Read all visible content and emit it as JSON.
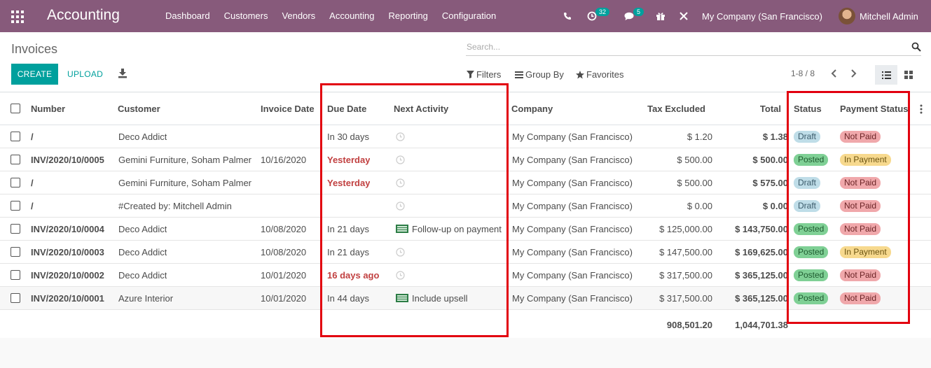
{
  "app": {
    "title": "Accounting"
  },
  "menu": [
    "Dashboard",
    "Customers",
    "Vendors",
    "Accounting",
    "Reporting",
    "Configuration"
  ],
  "systray": {
    "activity_count": "32",
    "message_count": "5",
    "company": "My Company (San Francisco)",
    "user": "Mitchell Admin"
  },
  "page": {
    "title": "Invoices"
  },
  "buttons": {
    "create": "CREATE",
    "upload": "UPLOAD"
  },
  "search": {
    "placeholder": "Search..."
  },
  "filters": {
    "filters": "Filters",
    "group_by": "Group By",
    "favorites": "Favorites"
  },
  "pager": {
    "text": "1-8 / 8"
  },
  "columns": [
    "Number",
    "Customer",
    "Invoice Date",
    "Due Date",
    "Next Activity",
    "Company",
    "Tax Excluded",
    "Total",
    "Status",
    "Payment Status"
  ],
  "rows": [
    {
      "number": "/",
      "customer": "Deco Addict",
      "invoice_date": "",
      "due_date": "In 30 days",
      "due_overdue": false,
      "activity": "",
      "activity_icon": "clock-icon",
      "company": "My Company (San Francisco)",
      "tax_excluded": "$ 1.20",
      "total": "$ 1.38",
      "status": "Draft",
      "payment_status": "Not Paid"
    },
    {
      "number": "INV/2020/10/0005",
      "customer": "Gemini Furniture, Soham Palmer",
      "invoice_date": "10/16/2020",
      "due_date": "Yesterday",
      "due_overdue": true,
      "activity": "",
      "activity_icon": "clock-icon",
      "company": "My Company (San Francisco)",
      "tax_excluded": "$ 500.00",
      "total": "$ 500.00",
      "status": "Posted",
      "payment_status": "In Payment"
    },
    {
      "number": "/",
      "customer": "Gemini Furniture, Soham Palmer",
      "invoice_date": "",
      "due_date": "Yesterday",
      "due_overdue": true,
      "activity": "",
      "activity_icon": "clock-icon",
      "company": "My Company (San Francisco)",
      "tax_excluded": "$ 500.00",
      "total": "$ 575.00",
      "status": "Draft",
      "payment_status": "Not Paid"
    },
    {
      "number": "/",
      "customer": "#Created by: Mitchell Admin",
      "invoice_date": "",
      "due_date": "",
      "due_overdue": false,
      "activity": "",
      "activity_icon": "clock-icon",
      "company": "My Company (San Francisco)",
      "tax_excluded": "$ 0.00",
      "total": "$ 0.00",
      "status": "Draft",
      "payment_status": "Not Paid"
    },
    {
      "number": "INV/2020/10/0004",
      "customer": "Deco Addict",
      "invoice_date": "10/08/2020",
      "due_date": "In 21 days",
      "due_overdue": false,
      "activity": "Follow-up on payment",
      "activity_icon": "money-icon",
      "company": "My Company (San Francisco)",
      "tax_excluded": "$ 125,000.00",
      "total": "$ 143,750.00",
      "status": "Posted",
      "payment_status": "Not Paid"
    },
    {
      "number": "INV/2020/10/0003",
      "customer": "Deco Addict",
      "invoice_date": "10/08/2020",
      "due_date": "In 21 days",
      "due_overdue": false,
      "activity": "",
      "activity_icon": "clock-icon",
      "company": "My Company (San Francisco)",
      "tax_excluded": "$ 147,500.00",
      "total": "$ 169,625.00",
      "status": "Posted",
      "payment_status": "In Payment"
    },
    {
      "number": "INV/2020/10/0002",
      "customer": "Deco Addict",
      "invoice_date": "10/01/2020",
      "due_date": "16 days ago",
      "due_overdue": true,
      "activity": "",
      "activity_icon": "clock-icon",
      "company": "My Company (San Francisco)",
      "tax_excluded": "$ 317,500.00",
      "total": "$ 365,125.00",
      "status": "Posted",
      "payment_status": "Not Paid"
    },
    {
      "number": "INV/2020/10/0001",
      "customer": "Azure Interior",
      "invoice_date": "10/01/2020",
      "due_date": "In 44 days",
      "due_overdue": false,
      "activity": "Include upsell",
      "activity_icon": "money-icon",
      "company": "My Company (San Francisco)",
      "tax_excluded": "$ 317,500.00",
      "total": "$ 365,125.00",
      "status": "Posted",
      "payment_status": "Not Paid"
    }
  ],
  "totals": {
    "tax_excluded": "908,501.20",
    "total": "1,044,701.38"
  },
  "colors": {
    "brand": "#875a7b",
    "accent": "#00a09d",
    "overdue": "#c14040",
    "draft_bg": "#bfdde8",
    "posted_bg": "#7fd095",
    "not_paid_bg": "#f0a8ab",
    "in_payment_bg": "#f7d98e",
    "highlight": "#e2000f"
  }
}
